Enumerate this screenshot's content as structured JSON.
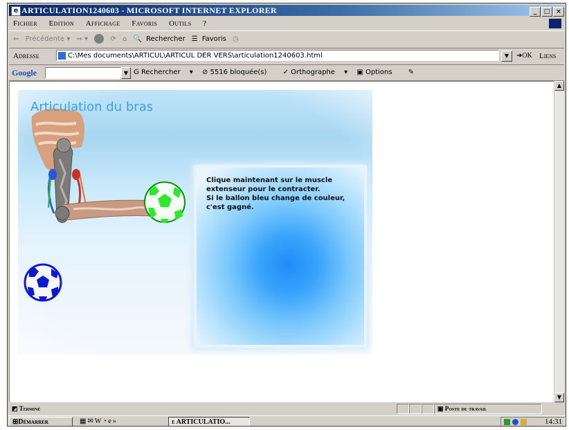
{
  "window": {
    "title": "ARTICULATION1240603 - MICROSOFT INTERNET EXPLORER",
    "buttons": [
      "_",
      "□",
      "×"
    ]
  },
  "menubar": {
    "items": [
      "Fichier",
      "Edition",
      "Affichage",
      "Favoris",
      "Outils",
      "?"
    ]
  },
  "toolbar": {
    "back": "Précédente",
    "search": "Rechercher",
    "favorites": "Favoris"
  },
  "address": {
    "label": "Adresse",
    "value": "C:\\Mes documents\\ARTICUL\\ARTICUL DER VERS\\articulation1240603.html",
    "go": "OK",
    "links": "Liens"
  },
  "google": {
    "logo": "Google",
    "search_button": "Rechercher",
    "blocked": "5516 bloquée(s)",
    "spelling": "Orthographe",
    "options": "Options"
  },
  "stage": {
    "title": "Articulation du bras",
    "instruction_lines": [
      "Clique maintenant sur le muscle",
      "extenseur pour le contracter.",
      "Si le ballon bleu change de couleur,",
      "c'est gagné."
    ]
  },
  "status": {
    "text": "Terminé",
    "zone": "Poste de travail"
  },
  "taskbar": {
    "start": "Démarrer",
    "task": "ARTICULATIO...",
    "quicklaunch_more": "»",
    "clock": "14:31"
  },
  "colors": {
    "title_bar": "#0a246a",
    "stage_title": "#3aa2d8",
    "ball_green": "#2ee82e",
    "ball_blue": "#1018d0"
  }
}
